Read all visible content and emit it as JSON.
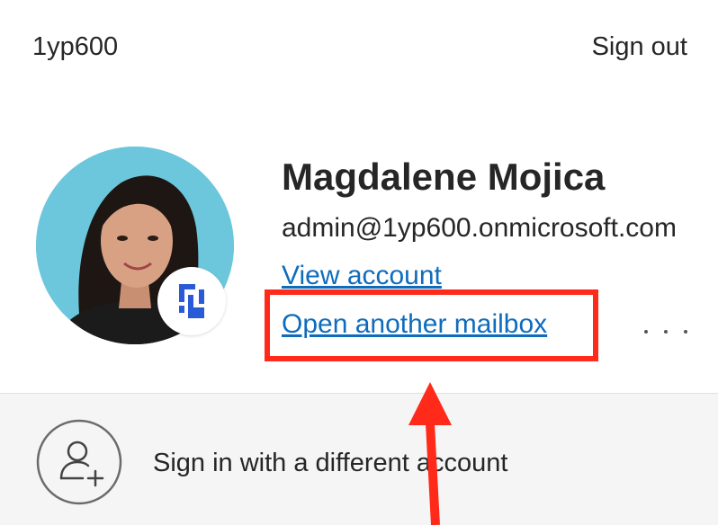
{
  "header": {
    "tenant_name": "1yp600",
    "sign_out_label": "Sign out"
  },
  "account": {
    "display_name": "Magdalene Mojica",
    "email": "admin@1yp600.onmicrosoft.com",
    "view_account_label": "View account",
    "open_mailbox_label": "Open another mailbox",
    "more_options_icon": "ellipsis-icon",
    "avatar_icon": "profile-photo",
    "badge_icon": "org-logo-icon"
  },
  "footer": {
    "sign_in_different_label": "Sign in with a different account",
    "icon": "person-add-icon"
  },
  "colors": {
    "link": "#0f6cbd",
    "annotation": "#ff2a1a",
    "footer_background": "#f5f5f5",
    "avatar_background": "#6cc7dc"
  }
}
